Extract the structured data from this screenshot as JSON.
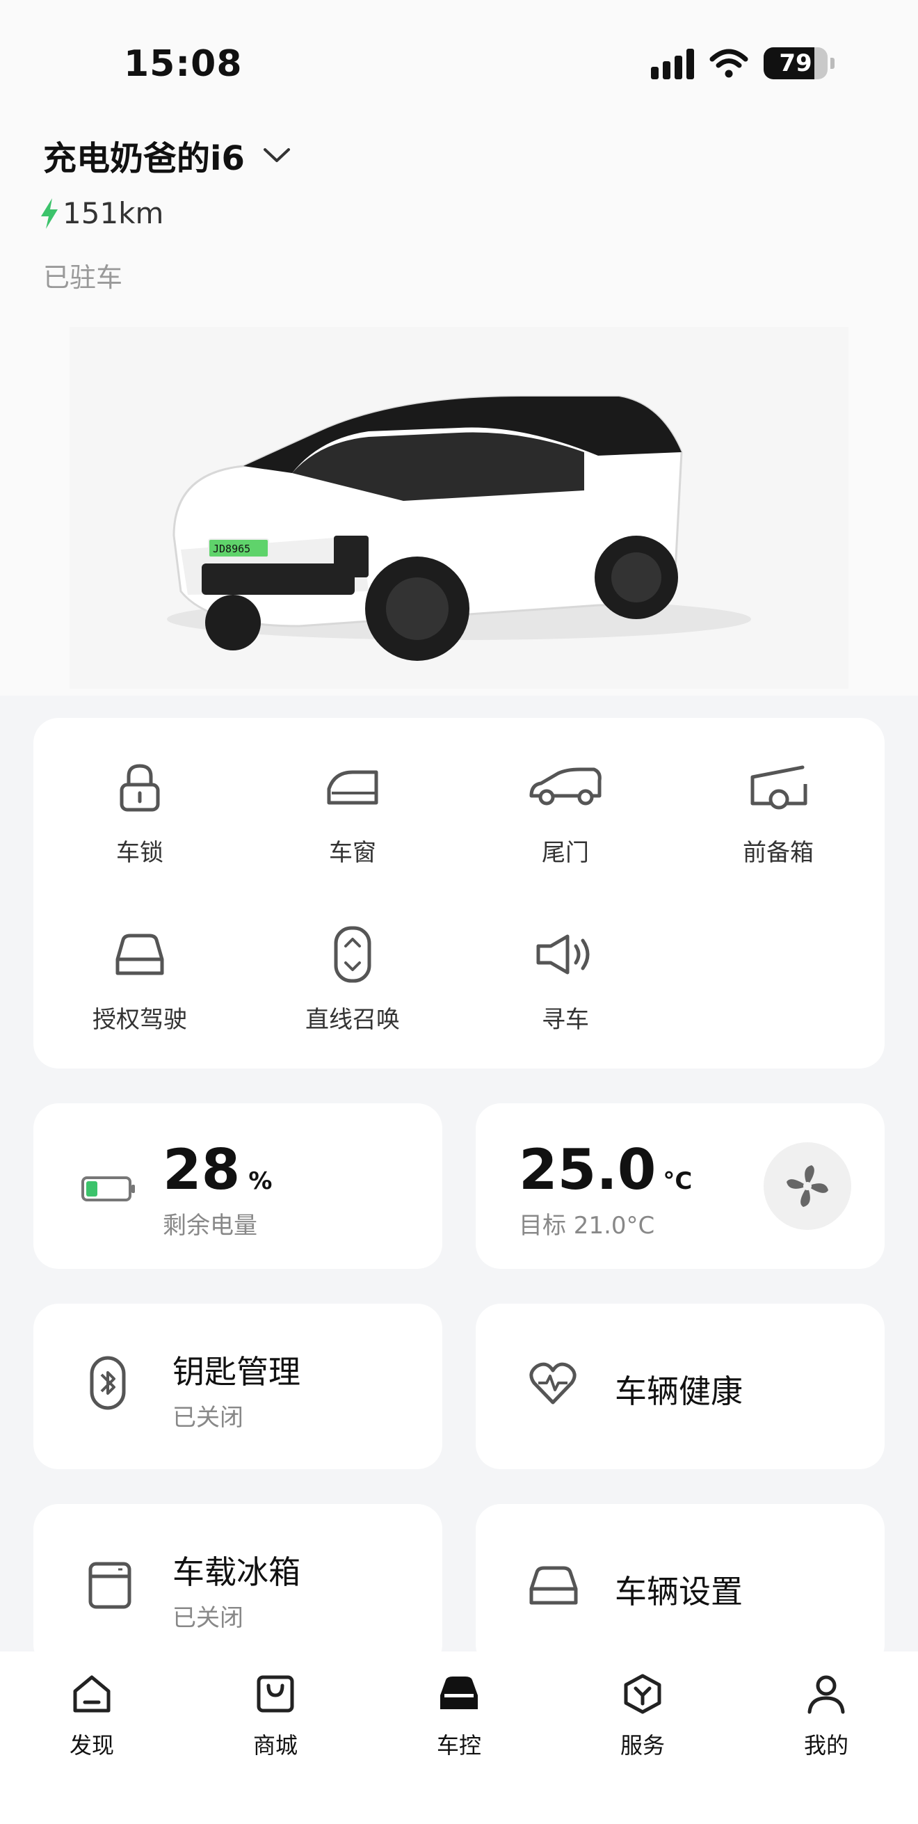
{
  "status_bar": {
    "time": "15:08",
    "battery": "79"
  },
  "header": {
    "vehicle_name": "充电奶爸的i6",
    "range": "151km",
    "park_status": "已驻车"
  },
  "car_image": {
    "plate": "JD8965"
  },
  "controls": [
    {
      "label": "车锁",
      "icon": "lock-icon"
    },
    {
      "label": "车窗",
      "icon": "window-icon"
    },
    {
      "label": "尾门",
      "icon": "tailgate-icon"
    },
    {
      "label": "前备箱",
      "icon": "frunk-icon"
    },
    {
      "label": "授权驾驶",
      "icon": "authorized-drive-icon"
    },
    {
      "label": "直线召唤",
      "icon": "summon-icon"
    },
    {
      "label": "寻车",
      "icon": "find-car-icon"
    }
  ],
  "battery_card": {
    "value": "28",
    "unit": "%",
    "label": "剩余电量",
    "level": 0.28
  },
  "climate_card": {
    "value": "25.0",
    "unit": "°C",
    "target": "目标 21.0°C"
  },
  "features": [
    {
      "title": "钥匙管理",
      "sub": "已关闭",
      "icon": "bluetooth-key-icon"
    },
    {
      "title": "车辆健康",
      "sub": "",
      "icon": "heart-pulse-icon"
    },
    {
      "title": "车载冰箱",
      "sub": "已关闭",
      "icon": "fridge-icon"
    },
    {
      "title": "车辆设置",
      "sub": "",
      "icon": "car-settings-icon"
    }
  ],
  "nav": [
    {
      "label": "发现",
      "icon": "home-icon"
    },
    {
      "label": "商城",
      "icon": "shopping-bag-icon"
    },
    {
      "label": "车控",
      "icon": "car-icon",
      "active": true
    },
    {
      "label": "服务",
      "icon": "service-icon"
    },
    {
      "label": "我的",
      "icon": "profile-icon"
    }
  ],
  "colors": {
    "accent_green": "#3cc36b",
    "text": "#111111",
    "muted": "#888888",
    "background": "#f4f5f7"
  }
}
